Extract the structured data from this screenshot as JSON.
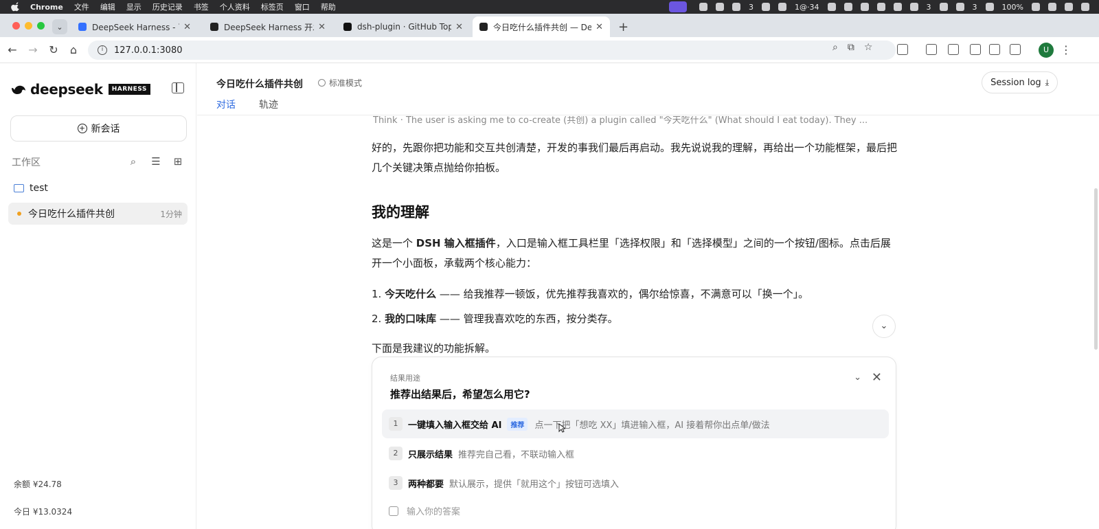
{
  "menubar": {
    "items": [
      "Chrome",
      "文件",
      "编辑",
      "显示",
      "历史记录",
      "书签",
      "个人资料",
      "标签页",
      "窗口",
      "帮助"
    ],
    "status": {
      "badge_3a": "3",
      "counter": "1@·34",
      "badge_3b": "3",
      "badge_3c": "3",
      "battery": "100%"
    }
  },
  "tabs": [
    {
      "title": "DeepSeek Harness - 飞书云文",
      "favicon_color": "#3370ff",
      "active": false
    },
    {
      "title": "DeepSeek Harness 开发者预览",
      "favicon_color": "#222222",
      "active": false
    },
    {
      "title": "dsh-plugin · GitHub Topics",
      "favicon_color": "#111111",
      "active": false
    },
    {
      "title": "今日吃什么插件共创 — DeepSe",
      "favicon_color": "#222222",
      "active": true
    }
  ],
  "address": {
    "url": "127.0.0.1:3080",
    "gemini_label": "问问 Gemini"
  },
  "sidebar": {
    "logo_word": "deepseek",
    "logo_badge": "HARNESS",
    "new_chat_label": "新会话",
    "workspace_label": "工作区",
    "folder_name": "test",
    "session": {
      "title": "今日吃什么插件共创",
      "time": "1分钟"
    },
    "balance_label": "余额 ¥24.78",
    "today_label": "今日 ¥13.0324"
  },
  "header": {
    "title": "今日吃什么插件共创",
    "mode": "标准模式",
    "tabs": [
      "对话",
      "轨迹"
    ],
    "session_log": "Session log"
  },
  "chat": {
    "think": "Think · The user is asking me to co-create (共创) a plugin called \"今天吃什么\" (What should I eat today). They ...",
    "intro": "好的，先跟你把功能和交互共创清楚，开发的事我们最后再启动。我先说说我的理解，再给出一个功能框架，最后把几个关键决策点抛给你拍板。",
    "heading": "我的理解",
    "p1_pre": "这是一个 ",
    "p1_bold": "DSH 输入框插件",
    "p1_post": "，入口是输入框工具栏里「选择权限」和「选择模型」之间的一个按钮/图标。点击后展开一个小面板，承载两个核心能力：",
    "list": [
      {
        "num": "1.",
        "bold": "今天吃什么",
        "rest": " —— 给我推荐一顿饭，优先推荐我喜欢的，偶尔给惊喜，不满意可以「换一个」。"
      },
      {
        "num": "2.",
        "bold": "我的口味库",
        "rest": " —— 管理我喜欢吃的东西，按分类存。"
      }
    ],
    "outro": "下面是我建议的功能拆解。"
  },
  "question": {
    "kicker": "结果用途",
    "title": "推荐出结果后，希望怎么用它?",
    "options": [
      {
        "num": "1",
        "label": "一键填入输入框交给 AI",
        "tag": "推荐",
        "desc": "点一下把「想吃 XX」填进输入框，AI 接着帮你出点单/做法"
      },
      {
        "num": "2",
        "label": "只展示结果",
        "tag": "",
        "desc": "推荐完自己看，不联动输入框"
      },
      {
        "num": "3",
        "label": "两种都要",
        "tag": "",
        "desc": "默认展示，提供「就用这个」按钮可选填入"
      }
    ],
    "answer_placeholder": "输入你的答案"
  }
}
